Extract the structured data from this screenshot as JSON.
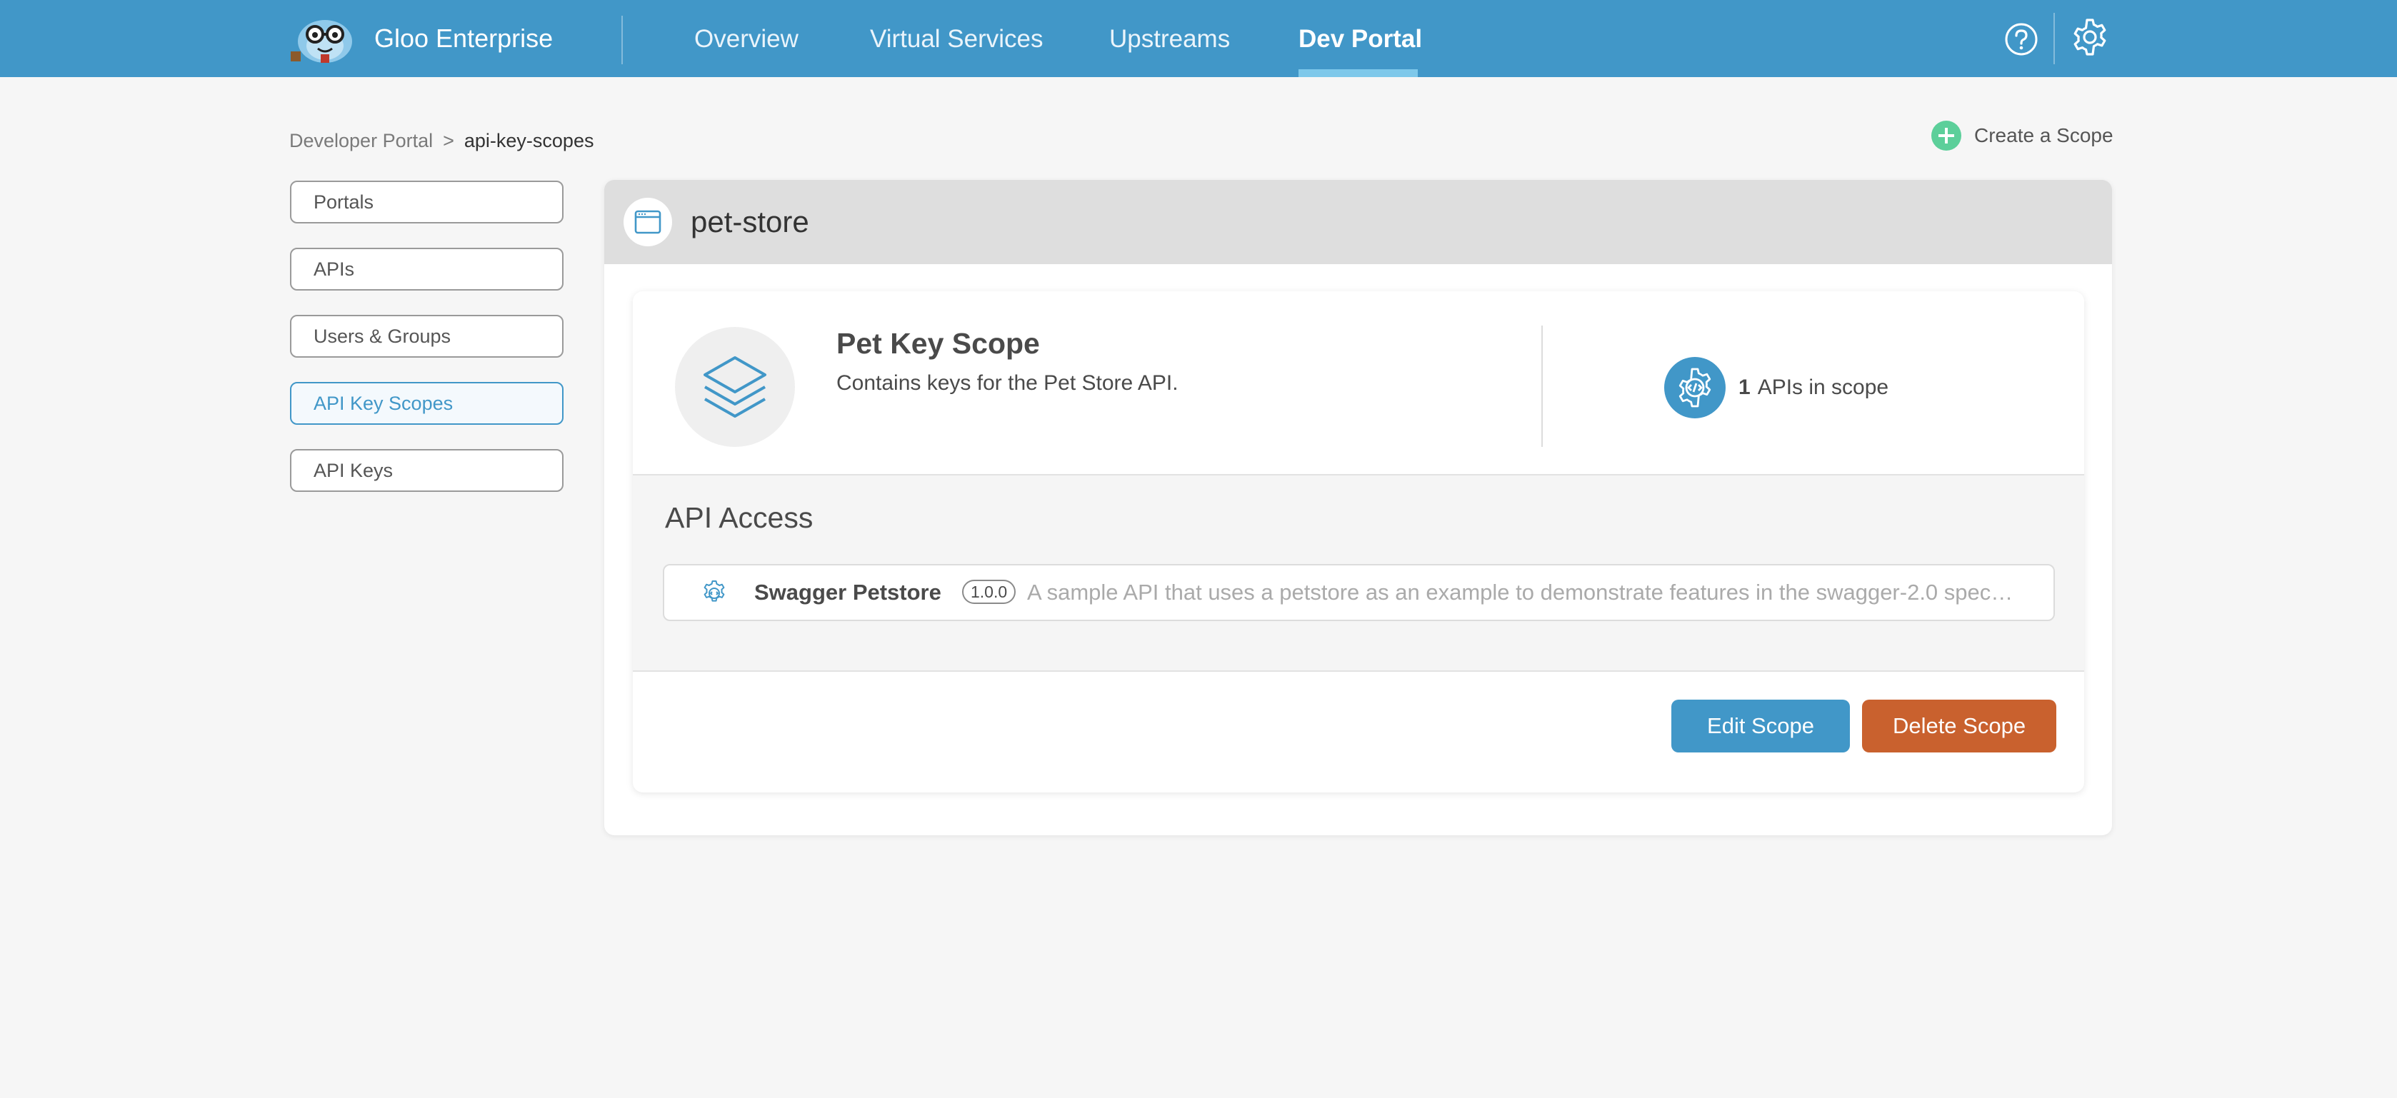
{
  "header": {
    "brand": "Gloo Enterprise",
    "nav": [
      {
        "label": "Overview",
        "active": false
      },
      {
        "label": "Virtual Services",
        "active": false
      },
      {
        "label": "Upstreams",
        "active": false
      },
      {
        "label": "Dev Portal",
        "active": true
      }
    ],
    "icons": {
      "help": "help-icon",
      "settings": "gear-icon"
    }
  },
  "breadcrumb": {
    "parent": "Developer Portal",
    "separator": ">",
    "current": "api-key-scopes"
  },
  "actions": {
    "create_scope": "Create a Scope"
  },
  "sidebar": {
    "items": [
      {
        "label": "Portals",
        "active": false
      },
      {
        "label": "APIs",
        "active": false
      },
      {
        "label": "Users & Groups",
        "active": false
      },
      {
        "label": "API Key Scopes",
        "active": true
      },
      {
        "label": "API Keys",
        "active": false
      }
    ]
  },
  "portal": {
    "name": "pet-store",
    "scope": {
      "name": "Pet Key Scope",
      "description": "Contains keys for the Pet Store API.",
      "api_count": "1",
      "api_count_suffix": "APIs in scope"
    },
    "access": {
      "title": "API Access",
      "apis": [
        {
          "name": "Swagger Petstore",
          "version": "1.0.0",
          "description": "A sample API that uses a petstore as an example to demonstrate features in the swagger-2.0 spec…"
        }
      ]
    },
    "buttons": {
      "edit": "Edit Scope",
      "delete": "Delete Scope"
    }
  },
  "colors": {
    "primary": "#4197c8",
    "danger": "#c9612e",
    "success": "#5ccf9a",
    "background": "#f6f6f6"
  }
}
